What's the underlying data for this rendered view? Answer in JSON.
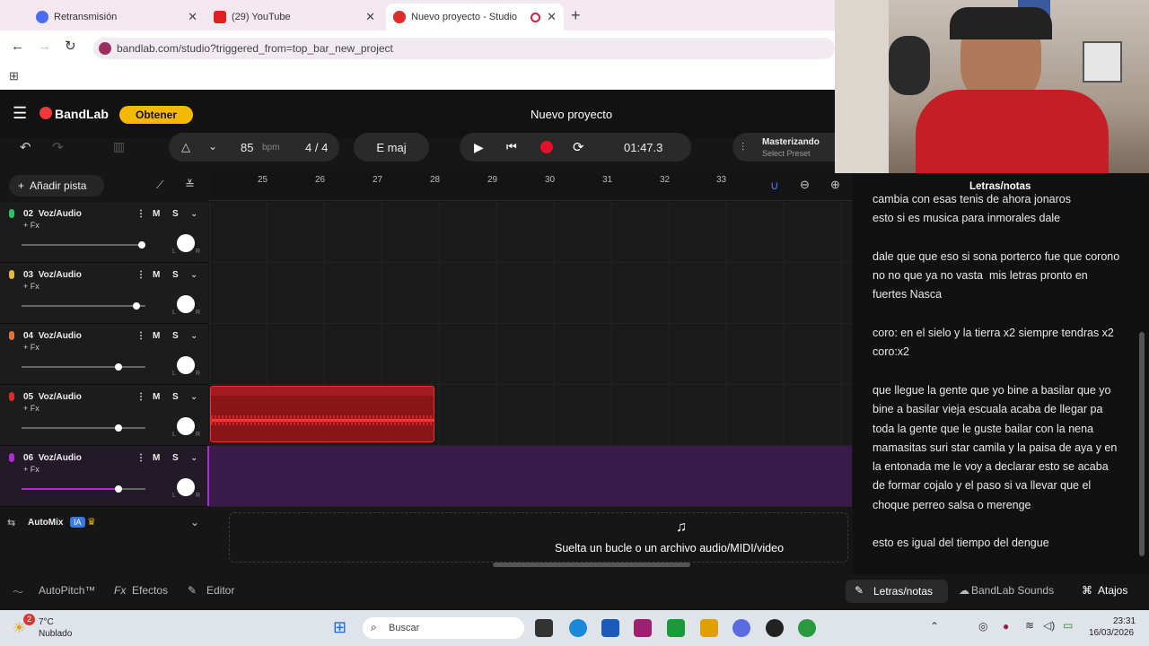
{
  "browser": {
    "tabs": [
      {
        "label": "Retransmisión"
      },
      {
        "label": "(29) YouTube"
      },
      {
        "label": "Nuevo proyecto - Studio"
      }
    ],
    "new_tab": "+",
    "url": "bandlab.com/studio?triggered_from=top_bar_new_project"
  },
  "app": {
    "brand": "BandLab",
    "get_button": "Obtener",
    "project_title": "Nuevo proyecto"
  },
  "toolbar": {
    "tempo": "85",
    "tempo_unit": "bpm",
    "time_sig": "4 / 4",
    "key": "E maj",
    "time": "01:47.3",
    "mastering_title": "Masterizando",
    "mastering_sub": "Select Preset"
  },
  "add_track": "Añadir pista",
  "bars": [
    "25",
    "26",
    "27",
    "28",
    "29",
    "30",
    "31",
    "32",
    "33"
  ],
  "tracks": [
    {
      "num": "02",
      "name": "Voz/Audio",
      "fx": "+ Fx",
      "m": "M",
      "s": "S",
      "color": "#27c46a",
      "vol": 0.97
    },
    {
      "num": "03",
      "name": "Voz/Audio",
      "fx": "+ Fx",
      "m": "M",
      "s": "S",
      "color": "#e8b83a",
      "vol": 0.93
    },
    {
      "num": "04",
      "name": "Voz/Audio",
      "fx": "+ Fx",
      "m": "M",
      "s": "S",
      "color": "#e0743a",
      "vol": 0.78
    },
    {
      "num": "05",
      "name": "Voz/Audio",
      "fx": "+ Fx",
      "m": "M",
      "s": "S",
      "color": "#e02b2b",
      "vol": 0.78
    },
    {
      "num": "06",
      "name": "Voz/Audio",
      "fx": "+ Fx",
      "m": "M",
      "s": "S",
      "color": "#b02ad8",
      "vol": 0.78
    }
  ],
  "automix": {
    "label": "AutoMix",
    "badge": "IA"
  },
  "drop_hint": "Suelta un bucle o un archivo audio/MIDI/video",
  "lyrics_panel": {
    "title": "Letras/notas",
    "text": "cambia con esas tenis de ahora jonaros\nesto si es musica para inmorales dale\n\ndale que que eso si sona porterco fue que corono no no que ya no vasta  mis letras pronto en fuertes Nasca\n\ncoro: en el sielo y la tierra x2 siempre tendras x2 coro:x2\n\nque llegue la gente que yo bine a basilar que yo bine a basilar vieja escuala acaba de llegar pa toda la gente que le guste bailar con la nena mamasitas suri star camila y la paisa de aya y en la entonada me le voy a declarar esto se acaba de formar cojalo y el paso si va llevar que el choque perreo salsa o merenge\n\nesto es igual del tiempo del dengue"
  },
  "bottom": {
    "autopitch": "AutoPitch™",
    "effects": "Efectos",
    "editor": "Editor",
    "lyrics_tab": "Letras/notas",
    "sounds_tab": "BandLab Sounds",
    "shortcuts_tab": "Atajos"
  },
  "taskbar": {
    "temp": "7°C",
    "weather": "Nublado",
    "badge": "2",
    "search": "Buscar",
    "clock": "23:31",
    "date": "16/03/2026"
  }
}
